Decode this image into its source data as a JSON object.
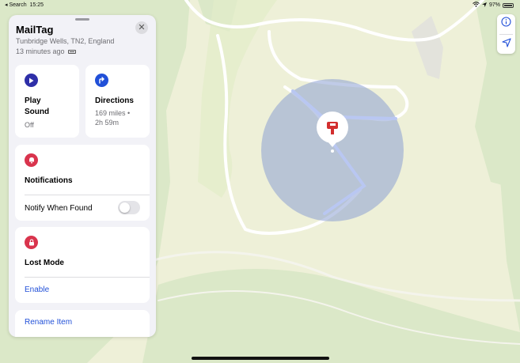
{
  "status_bar": {
    "back_label": "◂ Search",
    "time": "15:25",
    "battery_percent": "97%"
  },
  "item": {
    "name": "MailTag",
    "location": "Tunbridge Wells, TN2, England",
    "updated": "13 minutes ago"
  },
  "actions": {
    "play_sound": {
      "label_line1": "Play",
      "label_line2": "Sound",
      "sub": "Off",
      "icon": "play-icon",
      "color": "#2e2fa8"
    },
    "directions": {
      "label": "Directions",
      "sub_line1": "169 miles •",
      "sub_line2": "2h 59m",
      "icon": "arrow-turn-right-icon",
      "color": "#2150d8"
    }
  },
  "notifications": {
    "title": "Notifications",
    "row_label": "Notify When Found",
    "toggle_on": false,
    "icon": "bell-icon",
    "color": "#d9344d"
  },
  "lost_mode": {
    "title": "Lost Mode",
    "action": "Enable",
    "icon": "lock-icon",
    "color": "#d9344d"
  },
  "rename": {
    "label": "Rename Item"
  },
  "map": {
    "pin_icon": "mailbox-icon",
    "pin_color": "#d32f2f"
  }
}
